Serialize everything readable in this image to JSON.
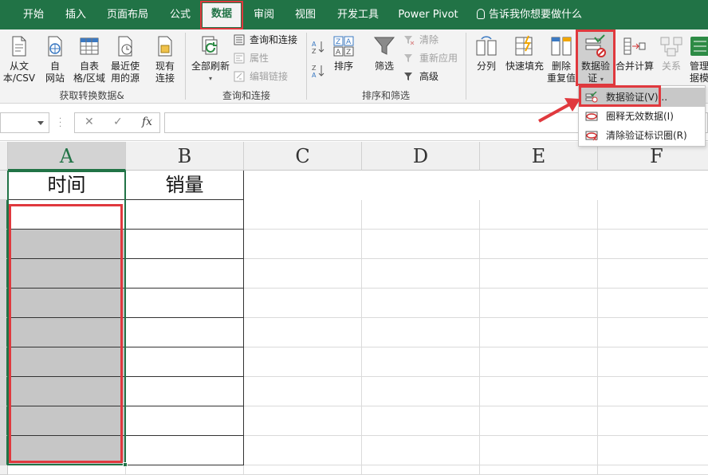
{
  "tabs": [
    {
      "label": "开始",
      "active": false
    },
    {
      "label": "插入",
      "active": false
    },
    {
      "label": "页面布局",
      "active": false
    },
    {
      "label": "公式",
      "active": false
    },
    {
      "label": "数据",
      "active": true
    },
    {
      "label": "审阅",
      "active": false
    },
    {
      "label": "视图",
      "active": false
    },
    {
      "label": "开发工具",
      "active": false
    },
    {
      "label": "Power Pivot",
      "active": false
    }
  ],
  "tell_me": "告诉我你想要做什么",
  "ribbon": {
    "get_data": {
      "from_text": "从文\n本/CSV",
      "from_web": "自\n网站",
      "from_table": "自表\n格/区域",
      "recent_sources": "最近使\n用的源",
      "existing": "现有\n连接",
      "group_label": "获取转换数据&"
    },
    "queries": {
      "refresh_all": "全部刷新",
      "queries_connections": "查询和连接",
      "properties": "属性",
      "edit_links": "编辑链接",
      "group_label": "查询和连接"
    },
    "sort_filter": {
      "sort": "排序",
      "filter": "筛选",
      "clear": "清除",
      "reapply": "重新应用",
      "advanced": "高级",
      "group_label": "排序和筛选"
    },
    "data_tools": {
      "text_to_columns": "分列",
      "flash_fill": "快速填充",
      "remove_duplicates": "删除\n重复值",
      "data_validation": "数据验\n证",
      "consolidate": "合并计算",
      "relationships": "关系",
      "manage_model": "管理\n据模"
    }
  },
  "dropdown": {
    "items": [
      {
        "label": "数据验证(V)...",
        "highlighted": true
      },
      {
        "label": "圈释无效数据(I)",
        "highlighted": false
      },
      {
        "label": "清除验证标识圈(R)",
        "highlighted": false
      }
    ]
  },
  "formula_bar": {
    "fx": "fx",
    "cancel": "✕",
    "enter": "✓"
  },
  "sheet": {
    "columns": [
      "A",
      "B",
      "C",
      "D",
      "E",
      "F"
    ],
    "header_row": {
      "A": "时间",
      "B": "销量"
    }
  },
  "colors": {
    "brand": "#217346",
    "highlight_red": "#e0393e",
    "selection_fill": "#c6c6c6"
  }
}
